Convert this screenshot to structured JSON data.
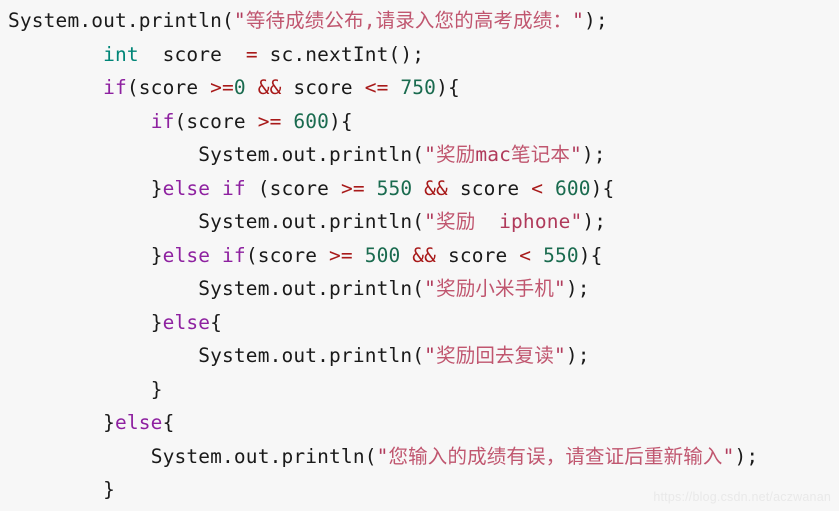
{
  "editor": {
    "background_color": "#f7f7f7",
    "language": "java",
    "font_size_px": 19.5,
    "theme_colors": {
      "plain": "#1a1a1a",
      "keyword": "#8e21a0",
      "type": "#008577",
      "number": "#1a6b4f",
      "operator": "#a81a1a",
      "string": "#b03a5b",
      "string_cjk": "#c0566f",
      "watermark": "#e9e9e9"
    }
  },
  "watermark": {
    "text": "https://blog.csdn.net/aczwanan"
  },
  "code": {
    "plain_text": "System.out.println(\"等待成绩公布,请录入您的高考成绩：\");\n        int  score  = sc.nextInt();\n        if(score >=0 && score <= 750){\n            if(score >= 600){\n                System.out.println(\"奖励mac笔记本\");\n            }else if (score >= 550 && score < 600){\n                System.out.println(\"奖励  iphone\");\n            }else if(score >= 500 && score < 550){\n                System.out.println(\"奖励小米手机\");\n            }else{\n                System.out.println(\"奖励回去复读\");\n            }\n        }else{\n            System.out.println(\"您输入的成绩有误，请查证后重新输入\");\n        }",
    "lines": [
      {
        "indent": "",
        "tokens": [
          {
            "t": "System.out.println",
            "c": "plain"
          },
          {
            "t": "(",
            "c": "punct"
          },
          {
            "t": "\"",
            "c": "string"
          },
          {
            "t": "等待成绩公布,请录入您的高考成绩：",
            "c": "string_cjk"
          },
          {
            "t": "\"",
            "c": "string"
          },
          {
            "t": ");",
            "c": "punct"
          }
        ]
      },
      {
        "indent": "        ",
        "tokens": [
          {
            "t": "int",
            "c": "type"
          },
          {
            "t": "  score  ",
            "c": "plain"
          },
          {
            "t": "=",
            "c": "operator"
          },
          {
            "t": " sc.nextInt();",
            "c": "plain"
          }
        ]
      },
      {
        "indent": "        ",
        "tokens": [
          {
            "t": "if",
            "c": "keyword"
          },
          {
            "t": "(score ",
            "c": "plain"
          },
          {
            "t": ">=",
            "c": "operator"
          },
          {
            "t": "0",
            "c": "number"
          },
          {
            "t": " ",
            "c": "plain"
          },
          {
            "t": "&&",
            "c": "operator"
          },
          {
            "t": " score ",
            "c": "plain"
          },
          {
            "t": "<=",
            "c": "operator"
          },
          {
            "t": " ",
            "c": "plain"
          },
          {
            "t": "750",
            "c": "number"
          },
          {
            "t": "){",
            "c": "punct"
          }
        ]
      },
      {
        "indent": "            ",
        "tokens": [
          {
            "t": "if",
            "c": "keyword"
          },
          {
            "t": "(score ",
            "c": "plain"
          },
          {
            "t": ">=",
            "c": "operator"
          },
          {
            "t": " ",
            "c": "plain"
          },
          {
            "t": "600",
            "c": "number"
          },
          {
            "t": "){",
            "c": "punct"
          }
        ]
      },
      {
        "indent": "                ",
        "tokens": [
          {
            "t": "System.out.println",
            "c": "plain"
          },
          {
            "t": "(",
            "c": "punct"
          },
          {
            "t": "\"",
            "c": "string"
          },
          {
            "t": "奖励",
            "c": "string_cjk"
          },
          {
            "t": "mac",
            "c": "string"
          },
          {
            "t": "笔记本",
            "c": "string_cjk"
          },
          {
            "t": "\"",
            "c": "string"
          },
          {
            "t": ");",
            "c": "punct"
          }
        ]
      },
      {
        "indent": "            ",
        "tokens": [
          {
            "t": "}",
            "c": "punct"
          },
          {
            "t": "else",
            "c": "keyword"
          },
          {
            "t": " ",
            "c": "plain"
          },
          {
            "t": "if",
            "c": "keyword"
          },
          {
            "t": " (score ",
            "c": "plain"
          },
          {
            "t": ">=",
            "c": "operator"
          },
          {
            "t": " ",
            "c": "plain"
          },
          {
            "t": "550",
            "c": "number"
          },
          {
            "t": " ",
            "c": "plain"
          },
          {
            "t": "&&",
            "c": "operator"
          },
          {
            "t": " score ",
            "c": "plain"
          },
          {
            "t": "<",
            "c": "operator"
          },
          {
            "t": " ",
            "c": "plain"
          },
          {
            "t": "600",
            "c": "number"
          },
          {
            "t": "){",
            "c": "punct"
          }
        ]
      },
      {
        "indent": "                ",
        "tokens": [
          {
            "t": "System.out.println",
            "c": "plain"
          },
          {
            "t": "(",
            "c": "punct"
          },
          {
            "t": "\"",
            "c": "string"
          },
          {
            "t": "奖励",
            "c": "string_cjk"
          },
          {
            "t": "  iphone",
            "c": "string"
          },
          {
            "t": "\"",
            "c": "string"
          },
          {
            "t": ");",
            "c": "punct"
          }
        ]
      },
      {
        "indent": "            ",
        "tokens": [
          {
            "t": "}",
            "c": "punct"
          },
          {
            "t": "else",
            "c": "keyword"
          },
          {
            "t": " ",
            "c": "plain"
          },
          {
            "t": "if",
            "c": "keyword"
          },
          {
            "t": "(score ",
            "c": "plain"
          },
          {
            "t": ">=",
            "c": "operator"
          },
          {
            "t": " ",
            "c": "plain"
          },
          {
            "t": "500",
            "c": "number"
          },
          {
            "t": " ",
            "c": "plain"
          },
          {
            "t": "&&",
            "c": "operator"
          },
          {
            "t": " score ",
            "c": "plain"
          },
          {
            "t": "<",
            "c": "operator"
          },
          {
            "t": " ",
            "c": "plain"
          },
          {
            "t": "550",
            "c": "number"
          },
          {
            "t": "){",
            "c": "punct"
          }
        ]
      },
      {
        "indent": "                ",
        "tokens": [
          {
            "t": "System.out.println",
            "c": "plain"
          },
          {
            "t": "(",
            "c": "punct"
          },
          {
            "t": "\"",
            "c": "string"
          },
          {
            "t": "奖励小米手机",
            "c": "string_cjk"
          },
          {
            "t": "\"",
            "c": "string"
          },
          {
            "t": ");",
            "c": "punct"
          }
        ]
      },
      {
        "indent": "            ",
        "tokens": [
          {
            "t": "}",
            "c": "punct"
          },
          {
            "t": "else",
            "c": "keyword"
          },
          {
            "t": "{",
            "c": "punct"
          }
        ]
      },
      {
        "indent": "                ",
        "tokens": [
          {
            "t": "System.out.println",
            "c": "plain"
          },
          {
            "t": "(",
            "c": "punct"
          },
          {
            "t": "\"",
            "c": "string"
          },
          {
            "t": "奖励回去复读",
            "c": "string_cjk"
          },
          {
            "t": "\"",
            "c": "string"
          },
          {
            "t": ");",
            "c": "punct"
          }
        ]
      },
      {
        "indent": "            ",
        "tokens": [
          {
            "t": "}",
            "c": "punct"
          }
        ]
      },
      {
        "indent": "        ",
        "tokens": [
          {
            "t": "}",
            "c": "punct"
          },
          {
            "t": "else",
            "c": "keyword"
          },
          {
            "t": "{",
            "c": "punct"
          }
        ]
      },
      {
        "indent": "            ",
        "tokens": [
          {
            "t": "System.out.println",
            "c": "plain"
          },
          {
            "t": "(",
            "c": "punct"
          },
          {
            "t": "\"",
            "c": "string"
          },
          {
            "t": "您输入的成绩有误，请查证后重新输入",
            "c": "string_cjk"
          },
          {
            "t": "\"",
            "c": "string"
          },
          {
            "t": ");",
            "c": "punct"
          }
        ]
      },
      {
        "indent": "        ",
        "tokens": [
          {
            "t": "}",
            "c": "punct"
          }
        ]
      }
    ]
  }
}
